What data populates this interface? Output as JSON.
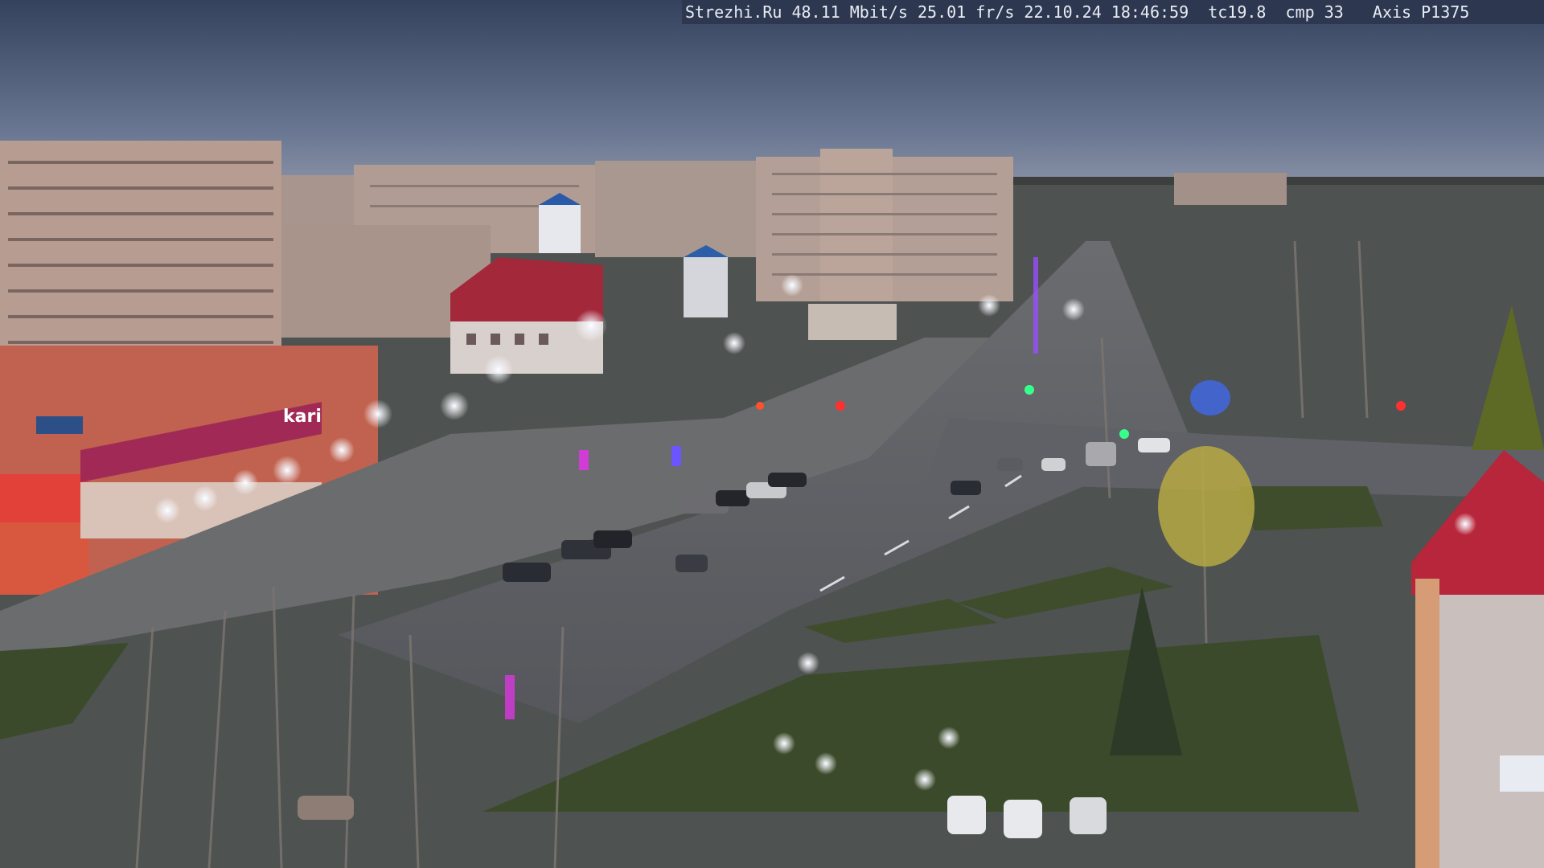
{
  "overlay": {
    "text": "Strezhi.Ru 48.11 Mbit/s 25.01 fr/s 22.10.24 18:46:59  tc19.8  cmp 33   Axis P1375"
  },
  "signs": {
    "store_name": "kari"
  },
  "colors": {
    "sky_top": "#3b4a66",
    "sky_horizon": "#7e8aa3",
    "road": "#5a5d63",
    "plaza": "#6a6b6d",
    "grass": "#3c4a2c",
    "building_pink": "#b69a8f",
    "store_magenta": "#a02a55",
    "roof_red": "#b8283a"
  }
}
